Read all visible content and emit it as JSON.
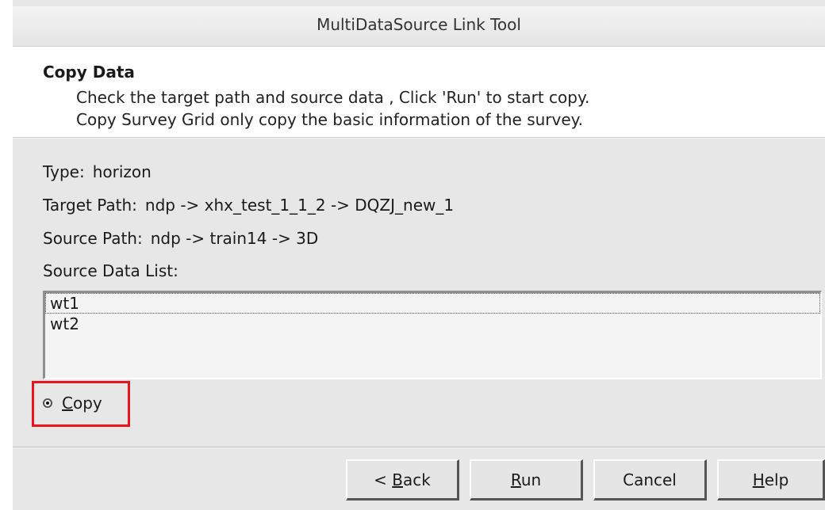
{
  "window": {
    "title": "MultiDataSource Link Tool"
  },
  "header": {
    "title": "Copy Data",
    "description_lines": [
      "Check the target path and source data ,  Click 'Run' to start copy.",
      "Copy Survey Grid only copy the basic information of the survey."
    ]
  },
  "info": {
    "type_label": "Type:",
    "type_value": "horizon",
    "target_label": "Target Path:",
    "target_value": "ndp -> xhx_test_1_1_2 -> DQZJ_new_1",
    "source_label": "Source Path:",
    "source_value": "ndp -> train14 -> 3D",
    "list_label": "Source Data List:"
  },
  "source_list": {
    "items": [
      "wt1",
      "wt2"
    ],
    "focused_index": 0
  },
  "copy_option": {
    "label_mnemonic": "C",
    "label_rest": "opy",
    "selected": true,
    "highlight_color": "#e8141b"
  },
  "buttons": {
    "back_prefix": "< ",
    "back_mnemonic": "B",
    "back_rest": "ack",
    "run_mnemonic": "R",
    "run_rest": "un",
    "cancel": "Cancel",
    "help_mnemonic": "H",
    "help_rest": "elp"
  }
}
